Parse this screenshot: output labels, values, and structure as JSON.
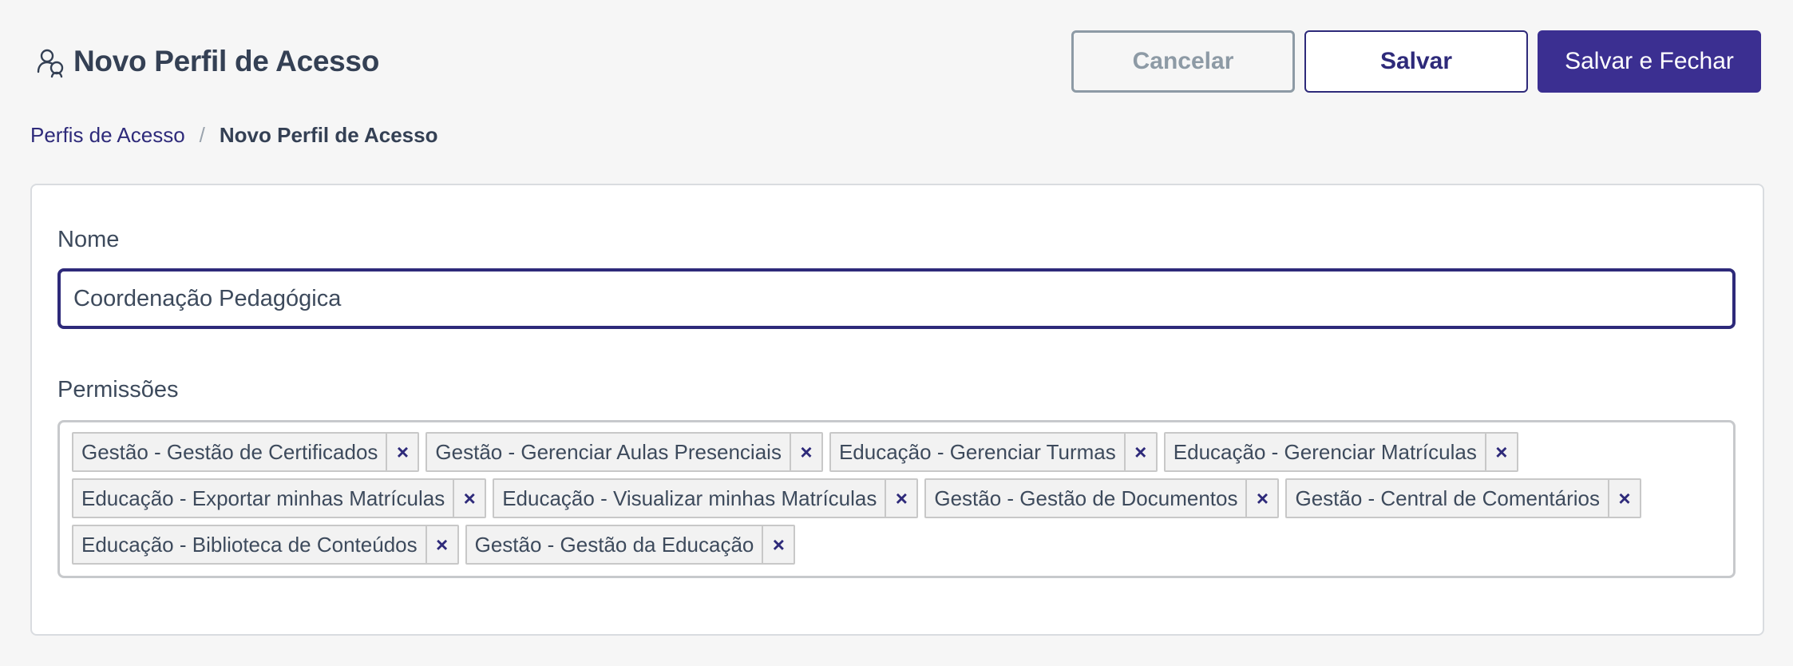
{
  "header": {
    "title": "Novo Perfil de Acesso",
    "icon": "user-group-icon"
  },
  "actions": {
    "cancel_label": "Cancelar",
    "save_label": "Salvar",
    "save_close_label": "Salvar e Fechar"
  },
  "breadcrumb": {
    "parent": "Perfis de Acesso",
    "separator": "/",
    "current": "Novo Perfil de Acesso"
  },
  "form": {
    "name_label": "Nome",
    "name_value": "Coordenação Pedagógica",
    "permissions_label": "Permissões",
    "remove_glyph": "×",
    "permission_rows": [
      [
        "Gestão - Gestão de Certificados",
        "Gestão - Gerenciar Aulas Presenciais",
        "Educação - Gerenciar Turmas",
        "Educação - Gerenciar Matrículas"
      ],
      [
        "Educação - Exportar minhas Matrículas",
        "Educação - Visualizar minhas Matrículas",
        "Gestão - Gestão de Documentos",
        "Gestão - Central de Comentários"
      ],
      [
        "Educação - Biblioteca de Conteúdos",
        "Gestão - Gestão da Educação"
      ]
    ]
  },
  "colors": {
    "primary": "#3b2f91",
    "primary_dark": "#2e2a7a",
    "muted": "#8d9aa5",
    "background": "#f6f6f6"
  }
}
